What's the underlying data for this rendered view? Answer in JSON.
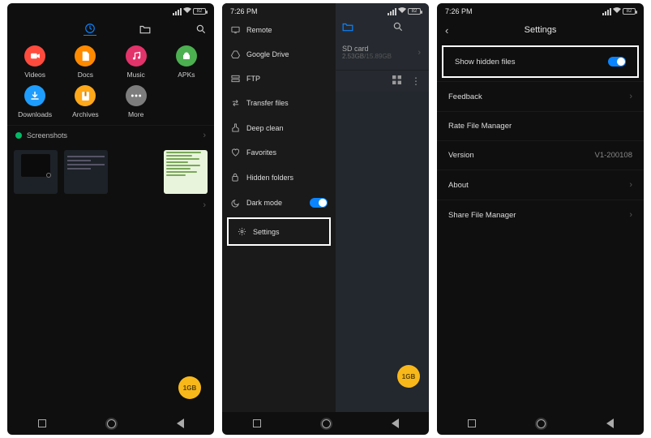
{
  "status": {
    "time": "7:26 PM",
    "batt": "82"
  },
  "screen1": {
    "items": [
      {
        "label": "Videos",
        "bg": "#ff4b3e",
        "glyph": "camera"
      },
      {
        "label": "Docs",
        "bg": "#ff8a00",
        "glyph": "doc"
      },
      {
        "label": "Music",
        "bg": "#e2336b",
        "glyph": "music"
      },
      {
        "label": "APKs",
        "bg": "#4caf50",
        "glyph": "apk"
      },
      {
        "label": "Downloads",
        "bg": "#1e9dff",
        "glyph": "down"
      },
      {
        "label": "Archives",
        "bg": "#ffa81a",
        "glyph": "zip"
      },
      {
        "label": "More",
        "bg": "#7d7d7d",
        "glyph": "more"
      }
    ],
    "section": "Screenshots",
    "badge": "1GB"
  },
  "screen2": {
    "drawer": [
      {
        "label": "Remote",
        "glyph": "monitor",
        "toggle": false
      },
      {
        "label": "Google Drive",
        "glyph": "drive",
        "toggle": false
      },
      {
        "label": "FTP",
        "glyph": "ftp",
        "toggle": false
      },
      {
        "label": "Transfer files",
        "glyph": "transfer",
        "toggle": false
      },
      {
        "label": "Deep clean",
        "glyph": "clean",
        "toggle": false
      },
      {
        "label": "Favorites",
        "glyph": "heart",
        "toggle": false
      },
      {
        "label": "Hidden folders",
        "glyph": "lock",
        "toggle": false
      },
      {
        "label": "Dark mode",
        "glyph": "moon",
        "toggle": true
      },
      {
        "label": "Settings",
        "glyph": "gear",
        "toggle": false,
        "highlight": true
      }
    ],
    "back": {
      "title": "SD card",
      "storage_used": "2.53GB",
      "storage_total": "15.89GB"
    },
    "badge": "1GB"
  },
  "screen3": {
    "title": "Settings",
    "rows": [
      {
        "label": "Show hidden files",
        "type": "toggle",
        "highlight": true
      },
      {
        "label": "Feedback",
        "type": "chev"
      },
      {
        "label": "Rate File Manager",
        "type": "none"
      },
      {
        "label": "Version",
        "type": "value",
        "value": "V1-200108"
      },
      {
        "label": "About",
        "type": "chev"
      },
      {
        "label": "Share File Manager",
        "type": "chev"
      }
    ]
  }
}
